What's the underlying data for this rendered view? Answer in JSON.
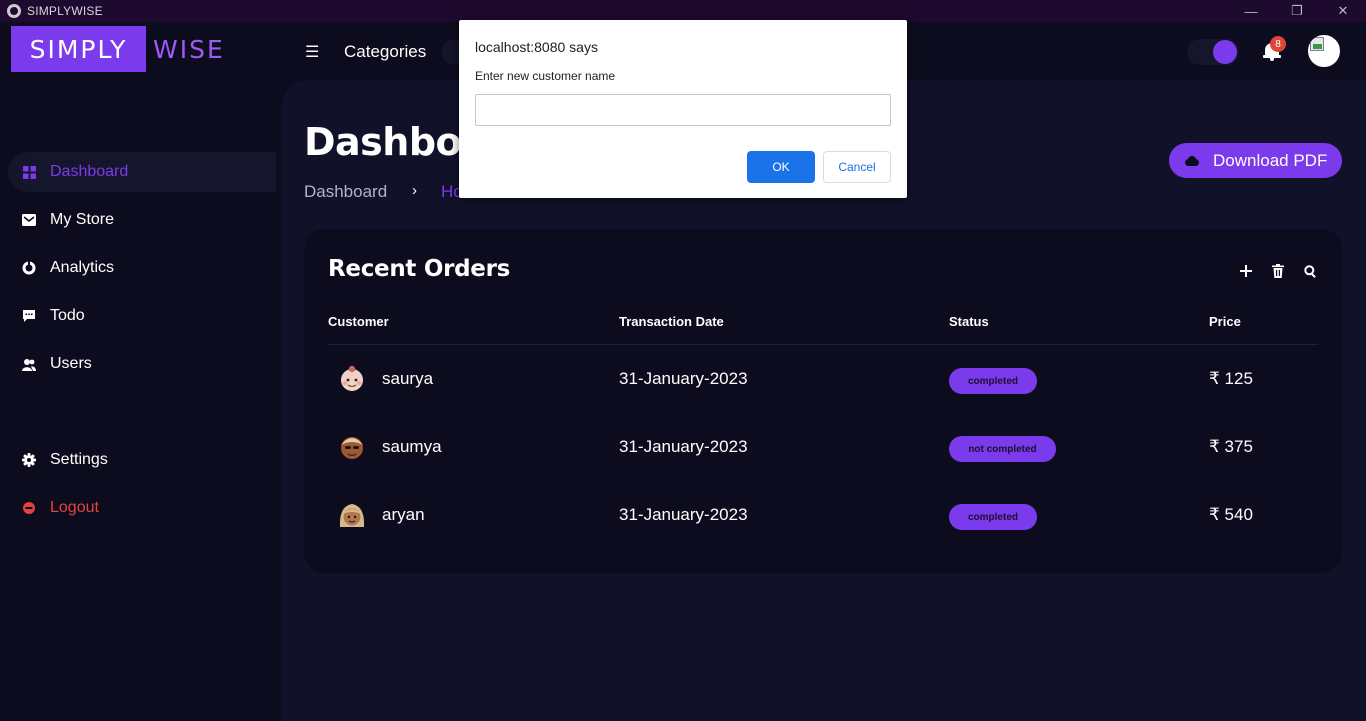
{
  "window": {
    "title": "SIMPLYWISE",
    "controls": [
      "—",
      "❐",
      "✕"
    ]
  },
  "brand": {
    "part1": "SIMPLY",
    "part2": "WISE"
  },
  "topnav": {
    "menu_icon": "menu-icon",
    "categories_label": "Categories",
    "notifications_count": "8",
    "accent_color": "#7c3aed"
  },
  "sidebar": {
    "items": [
      {
        "label": "Dashboard",
        "icon": "grid-icon",
        "active": true
      },
      {
        "label": "My Store",
        "icon": "store-icon"
      },
      {
        "label": "Analytics",
        "icon": "pie-chart-icon"
      },
      {
        "label": "Todo",
        "icon": "message-icon"
      },
      {
        "label": "Users",
        "icon": "users-icon"
      },
      {
        "label": "Settings",
        "icon": "gear-icon"
      },
      {
        "label": "Logout",
        "icon": "logout-icon",
        "danger": true
      }
    ]
  },
  "page": {
    "title": "Dashboard",
    "breadcrumb": {
      "first": "Dashboard",
      "separator": "›",
      "second": "Home"
    },
    "download_label": "Download PDF"
  },
  "orders": {
    "title": "Recent Orders",
    "actions": [
      "add-icon",
      "trash-icon",
      "search-icon"
    ],
    "columns": [
      "Customer",
      "Transaction Date",
      "Status",
      "Price"
    ],
    "rows": [
      {
        "customer": "saurya",
        "date": "31-January-2023",
        "status": "completed",
        "price": "₹ 125"
      },
      {
        "customer": "saumya",
        "date": "31-January-2023",
        "status": "not completed",
        "price": "₹ 375"
      },
      {
        "customer": "aryan",
        "date": "31-January-2023",
        "status": "completed",
        "price": "₹ 540"
      }
    ]
  },
  "dialog": {
    "origin": "localhost:8080 says",
    "message": "Enter new customer name",
    "input_value": "",
    "ok_label": "OK",
    "cancel_label": "Cancel"
  }
}
